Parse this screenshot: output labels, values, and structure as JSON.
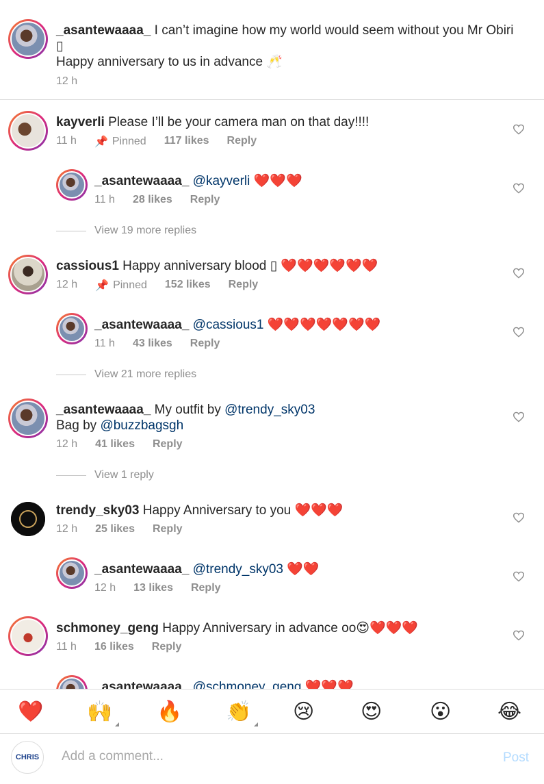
{
  "caption": {
    "username": "_asantewaaaa_",
    "text_line1": " I can’t imagine how my world would seem without you Mr Obiri",
    "text_line2": "\u0000",
    "text_line3": "Happy anniversary to us in advance 🥂",
    "time": "12 h"
  },
  "comments": [
    {
      "username": "kayverli",
      "text": " Please I’ll be your camera man on that day!!!!",
      "time": "11 h",
      "pinned": "Pinned",
      "likes": "117 likes",
      "reply": "Reply",
      "replies": [
        {
          "username": "_asantewaaaa_",
          "mention": "@kayverli",
          "text": " ❤️❤️❤️",
          "time": "11 h",
          "likes": "28 likes",
          "reply": "Reply"
        }
      ],
      "view_more": "View 19 more replies"
    },
    {
      "username": "cassious1",
      "text": " Happy anniversary blood ",
      "text_hearts": "❤️❤️❤️❤️❤️❤️",
      "time": "12 h",
      "pinned": "Pinned",
      "likes": "152 likes",
      "reply": "Reply",
      "replies": [
        {
          "username": "_asantewaaaa_",
          "mention": "@cassious1",
          "text": " ❤️❤️❤️❤️❤️❤️❤️",
          "time": "11 h",
          "likes": "43 likes",
          "reply": "Reply"
        }
      ],
      "view_more": "View 21 more replies"
    },
    {
      "username": "_asantewaaaa_",
      "text": " My outfit by ",
      "mention1": "@trendy_sky03",
      "text2": "Bag by ",
      "mention2": "@buzzbagsgh",
      "time": "12 h",
      "likes": "41 likes",
      "reply": "Reply",
      "view_more": "View 1 reply"
    },
    {
      "username": "trendy_sky03",
      "text": " Happy Anniversary to you ❤️❤️❤️",
      "time": "12 h",
      "likes": "25 likes",
      "reply": "Reply",
      "replies": [
        {
          "username": "_asantewaaaa_",
          "mention": "@trendy_sky03",
          "text": " ❤️❤️",
          "time": "12 h",
          "likes": "13 likes",
          "reply": "Reply"
        }
      ]
    },
    {
      "username": "schmoney_geng",
      "text": " Happy Anniversary in advance oo😍❤️❤️❤️",
      "time": "11 h",
      "likes": "16 likes",
      "reply": "Reply"
    }
  ],
  "partial_reply": {
    "username": "_asantewaaaa_",
    "mention": "@schmoney_geng",
    "text": " ❤️❤️❤️"
  },
  "emoji_bar": [
    "❤️",
    "🙌",
    "🔥",
    "👏",
    "😢",
    "😍",
    "😮",
    "😂"
  ],
  "comment_box": {
    "placeholder": "Add a comment...",
    "post_label": "Post",
    "my_avatar_text": "CHRIS"
  },
  "colors": {
    "mention": "#003569",
    "meta": "#8e8e8e",
    "post_disabled": "#b3dbff",
    "heart": "#ed4956"
  }
}
